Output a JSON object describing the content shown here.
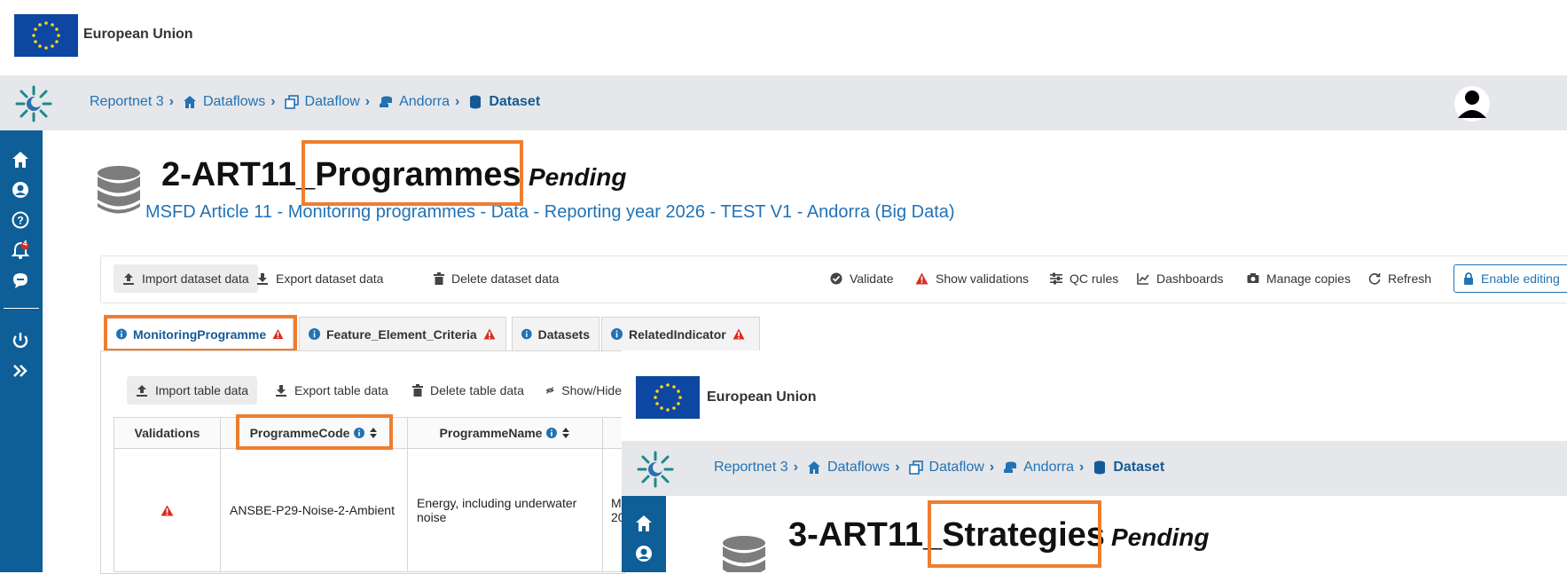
{
  "eu_header": {
    "title": "European Union"
  },
  "breadcrumbs": [
    {
      "label": "Reportnet 3",
      "icon": "none"
    },
    {
      "label": "Dataflows",
      "icon": "home-icon"
    },
    {
      "label": "Dataflow",
      "icon": "clone-icon"
    },
    {
      "label": "Andorra",
      "icon": "coins-icon"
    },
    {
      "label": "Dataset",
      "icon": "database-icon"
    }
  ],
  "sidebar": {
    "items": [
      "home-icon",
      "user-icon",
      "help-icon",
      "notifications-icon",
      "feedback-icon",
      "logout-icon",
      "expand-icon"
    ],
    "notification_count": "4"
  },
  "dataset": {
    "title": "2-ART11_Programmes",
    "status": "Pending",
    "subtitle": "MSFD Article 11 - Monitoring programmes - Data - Reporting year 2026 - TEST V1 - Andorra (Big Data)"
  },
  "toolbar": {
    "import": "Import dataset data",
    "export": "Export dataset data",
    "delete": "Delete dataset data",
    "validate": "Validate",
    "show_validations": "Show validations",
    "qc_rules": "QC rules",
    "dashboards": "Dashboards",
    "manage_copies": "Manage copies",
    "refresh": "Refresh",
    "enable_editing": "Enable editing"
  },
  "tabs": [
    {
      "label": "MonitoringProgramme",
      "warning": true
    },
    {
      "label": "Feature_Element_Criteria",
      "warning": true
    },
    {
      "label": "Datasets",
      "warning": false
    },
    {
      "label": "RelatedIndicator",
      "warning": true
    }
  ],
  "table_toolbar": {
    "import": "Import table data",
    "export": "Export table data",
    "delete": "Delete table data",
    "show_hide": "Show/Hide"
  },
  "table": {
    "columns": [
      "Validations",
      "ProgrammeCode",
      "ProgrammeName"
    ],
    "row": {
      "programme_code": "ANSBE-P29-Noise-2-Ambient",
      "programme_name": "Energy, including underwater noise",
      "next_col_fragment_1": "M",
      "next_col_fragment_2": "20"
    }
  },
  "overlay": {
    "eu_title": "European Union",
    "breadcrumbs": [
      "Reportnet 3",
      "Dataflows",
      "Dataflow",
      "Andorra",
      "Dataset"
    ],
    "title": "3-ART11_Strategies",
    "status": "Pending"
  },
  "colors": {
    "accent": "#2272b4",
    "sidebar": "#0e5e97",
    "highlight": "#ef7d2f",
    "warning": "#d92d20"
  }
}
